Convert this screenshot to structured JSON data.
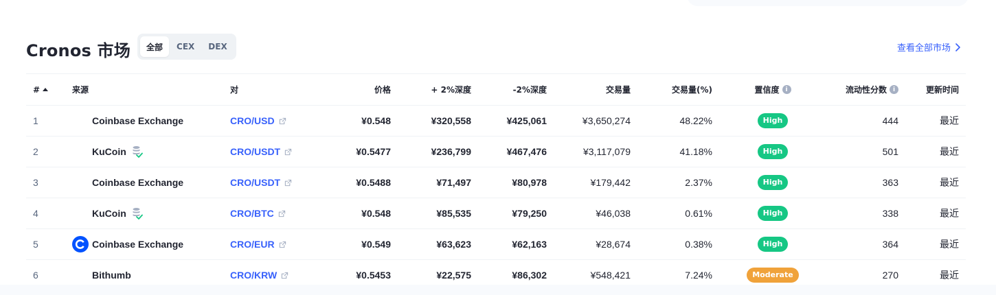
{
  "header": {
    "title": "Cronos 市场",
    "filters": [
      {
        "label": "全部",
        "active": true
      },
      {
        "label": "CEX",
        "active": false
      },
      {
        "label": "DEX",
        "active": false
      }
    ],
    "view_all": "查看全部市场"
  },
  "table": {
    "columns": {
      "rank": "#",
      "source": "来源",
      "pair": "对",
      "price": "价格",
      "depth_plus": "+ 2%深度",
      "depth_minus": "-2%深度",
      "volume": "交易量",
      "volume_pct": "交易量(%)",
      "confidence": "置信度",
      "liquidity": "流动性分数",
      "updated": "更新时间"
    },
    "rows": [
      {
        "rank": "1",
        "source": "Coinbase Exchange",
        "logo": "none",
        "verified": false,
        "pair": "CRO/USD",
        "price": "¥0.548",
        "depth_plus": "¥320,558",
        "depth_minus": "¥425,061",
        "volume": "¥3,650,274",
        "volume_pct": "48.22%",
        "confidence": "High",
        "liquidity": "444",
        "updated": "最近"
      },
      {
        "rank": "2",
        "source": "KuCoin",
        "logo": "none",
        "verified": true,
        "pair": "CRO/USDT",
        "price": "¥0.5477",
        "depth_plus": "¥236,799",
        "depth_minus": "¥467,476",
        "volume": "¥3,117,079",
        "volume_pct": "41.18%",
        "confidence": "High",
        "liquidity": "501",
        "updated": "最近"
      },
      {
        "rank": "3",
        "source": "Coinbase Exchange",
        "logo": "none",
        "verified": false,
        "pair": "CRO/USDT",
        "price": "¥0.5488",
        "depth_plus": "¥71,497",
        "depth_minus": "¥80,978",
        "volume": "¥179,442",
        "volume_pct": "2.37%",
        "confidence": "High",
        "liquidity": "363",
        "updated": "最近"
      },
      {
        "rank": "4",
        "source": "KuCoin",
        "logo": "none",
        "verified": true,
        "pair": "CRO/BTC",
        "price": "¥0.548",
        "depth_plus": "¥85,535",
        "depth_minus": "¥79,250",
        "volume": "¥46,038",
        "volume_pct": "0.61%",
        "confidence": "High",
        "liquidity": "338",
        "updated": "最近"
      },
      {
        "rank": "5",
        "source": "Coinbase Exchange",
        "logo": "coinbase-logo",
        "verified": false,
        "pair": "CRO/EUR",
        "price": "¥0.549",
        "depth_plus": "¥63,623",
        "depth_minus": "¥62,163",
        "volume": "¥28,674",
        "volume_pct": "0.38%",
        "confidence": "High",
        "liquidity": "364",
        "updated": "最近"
      },
      {
        "rank": "6",
        "source": "Bithumb",
        "logo": "none",
        "verified": false,
        "pair": "CRO/KRW",
        "price": "¥0.5453",
        "depth_plus": "¥22,575",
        "depth_minus": "¥86,302",
        "volume": "¥548,421",
        "volume_pct": "7.24%",
        "confidence": "Moderate",
        "liquidity": "270",
        "updated": "最近"
      }
    ]
  },
  "colors": {
    "link": "#3861fb",
    "high": "#16c784",
    "moderate": "#f0a23a",
    "coinbase": "#0052ff",
    "verified": "#16c784",
    "db": "#a6b0c3"
  },
  "icons": {
    "sort": "sort-up-icon",
    "external": "external-link-icon",
    "info": "info-icon",
    "chevron": "chevron-right-icon",
    "verified": "database-check-icon"
  }
}
